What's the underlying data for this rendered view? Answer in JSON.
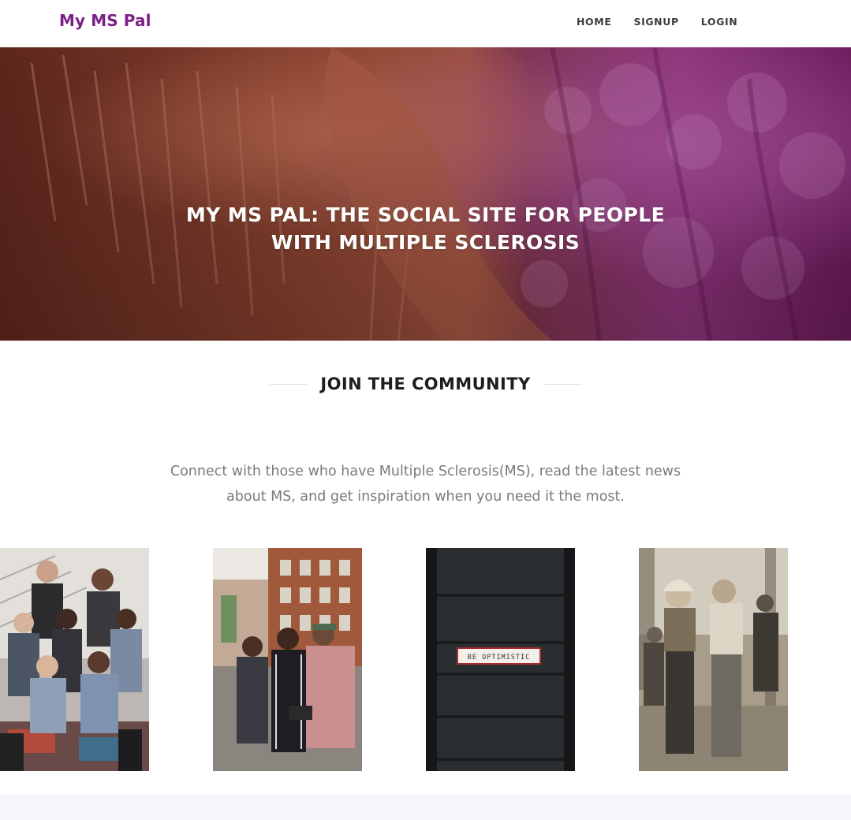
{
  "nav": {
    "brand": "My MS Pal",
    "links": [
      "HOME",
      "SIGNUP",
      "LOGIN"
    ]
  },
  "hero": {
    "title_line1": "MY MS PAL: THE SOCIAL SITE FOR PEOPLE",
    "title_line2": "WITH MULTIPLE SCLEROSIS"
  },
  "community": {
    "heading": "JOIN THE COMMUNITY",
    "intro_line1": "Connect with those who have Multiple Sclerosis(MS), read the latest news",
    "intro_line2": "about MS, and get inspiration when you need it the most."
  },
  "gallery": {
    "sign_text": "BE OPTIMISTIC"
  },
  "colors": {
    "brand": "#7b1f86",
    "nav_text": "#3d3d3d",
    "heading": "#1e1e1e",
    "body_text": "#7a7a7a"
  }
}
